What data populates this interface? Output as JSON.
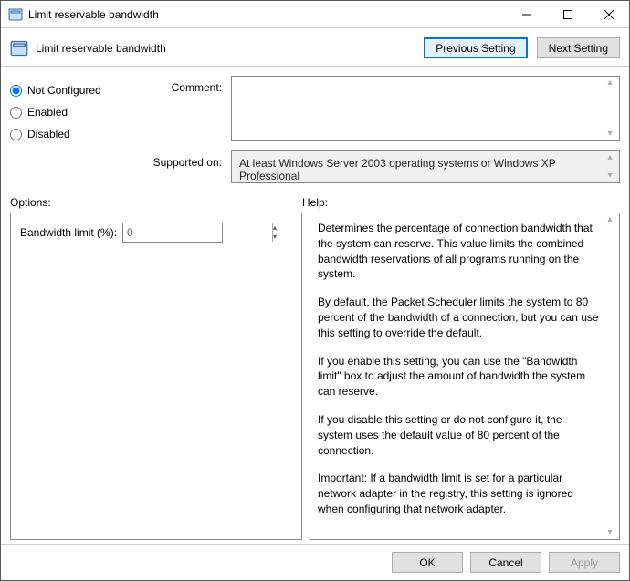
{
  "window": {
    "title": "Limit reservable bandwidth"
  },
  "header": {
    "title": "Limit reservable bandwidth"
  },
  "nav": {
    "prev": "Previous Setting",
    "next": "Next Setting"
  },
  "state": {
    "not_configured": "Not Configured",
    "enabled": "Enabled",
    "disabled": "Disabled",
    "selected": "not_configured"
  },
  "labels": {
    "comment": "Comment:",
    "supported": "Supported on:",
    "options": "Options:",
    "help": "Help:",
    "bandwidth_limit": "Bandwidth limit (%):"
  },
  "supported_text": "At least Windows Server 2003 operating systems or Windows XP Professional",
  "options": {
    "bandwidth_value": "0"
  },
  "help": {
    "p1": "Determines the percentage of connection bandwidth that the system can reserve. This value limits the combined bandwidth reservations of all programs running on the system.",
    "p2": "By default, the Packet Scheduler limits the system to 80 percent of the bandwidth of a connection, but you can use this setting to override the default.",
    "p3": "If you enable this setting, you can use the \"Bandwidth limit\" box to adjust the amount of bandwidth the system can reserve.",
    "p4": "If you disable this setting or do not configure it, the system uses the default value of 80 percent of the connection.",
    "p5": "Important: If a bandwidth limit is set for a particular network adapter in the registry, this setting is ignored when configuring that network adapter."
  },
  "footer": {
    "ok": "OK",
    "cancel": "Cancel",
    "apply": "Apply"
  }
}
